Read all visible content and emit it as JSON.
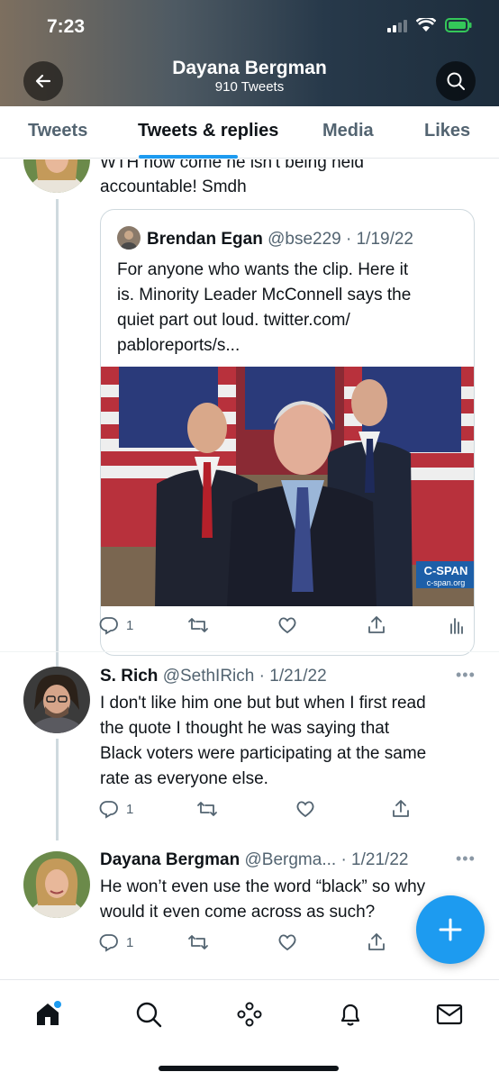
{
  "status_bar": {
    "time": "7:23"
  },
  "header": {
    "name": "Dayana Bergman",
    "tweet_count": "910 Tweets"
  },
  "tabs": [
    {
      "label": "Tweets"
    },
    {
      "label": "Tweets & replies"
    },
    {
      "label": "Media"
    },
    {
      "label": "Likes"
    }
  ],
  "tweet_partial": {
    "text_line1": "WTH how come he isn't being held",
    "text_line2": "accountable! Smdh",
    "quote": {
      "name": "Brendan Egan",
      "handle": "@bse229",
      "date": "· 1/19/22",
      "lines": [
        "For anyone who wants the clip. Here it",
        "is. Minority Leader McConnell says the",
        "quiet part out loud. twitter.com/",
        "pabloreports/s..."
      ],
      "media_watermark": "C-SPAN",
      "media_watermark_sub": "c-span.org"
    },
    "reply_count": "1"
  },
  "tweet_2": {
    "name": "S. Rich",
    "handle": "@SethIRich",
    "date": "· 1/21/22",
    "lines": [
      "I don't like him one but but when I first read",
      "the quote I thought he was saying that",
      "Black voters were participating at the same",
      "rate as everyone else."
    ],
    "reply_count": "1"
  },
  "tweet_3": {
    "name": "Dayana Bergman",
    "handle": "@Bergma...",
    "date": "· 1/21/22",
    "lines": [
      "He won’t even use the word “black” so why",
      "would it even come across as such?"
    ],
    "reply_count": "1"
  },
  "icons": {
    "back": "arrow-left-icon",
    "search": "search-icon",
    "reply": "reply-icon",
    "retweet": "retweet-icon",
    "like": "heart-icon",
    "share": "share-icon",
    "analytics": "analytics-icon",
    "compose": "plus-icon",
    "nav": [
      "home-icon",
      "search-icon",
      "spaces-icon",
      "bell-icon",
      "mail-icon"
    ]
  },
  "colors": {
    "accent": "#1d9bf0",
    "text": "#0f1419",
    "secondary": "#536471"
  }
}
